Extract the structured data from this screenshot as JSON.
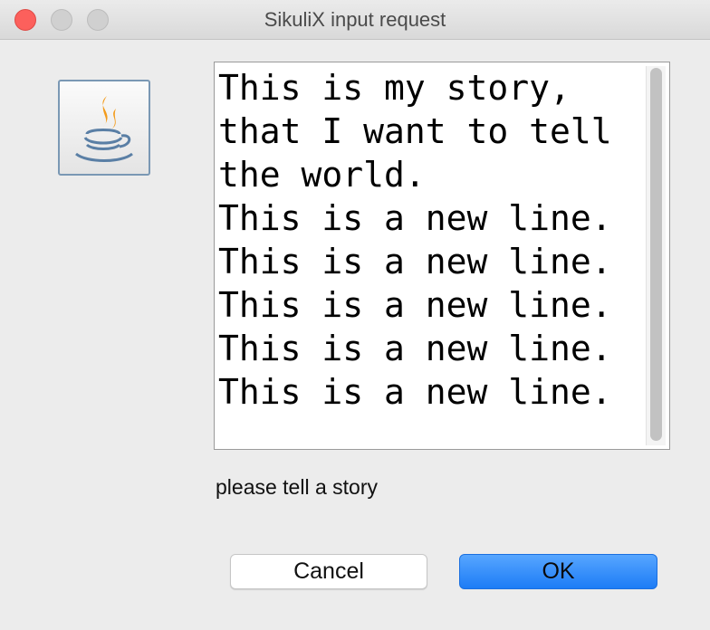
{
  "window": {
    "title": "SikuliX input request"
  },
  "icon": {
    "name": "java-cup-icon",
    "colors": {
      "steam": "#f39b1b",
      "cup": "#5a7fa5",
      "frame": "#7a98b4"
    }
  },
  "story": {
    "text": "This is my story,\nthat I want to tell\nthe world.\nThis is a new line.\nThis is a new line.\nThis is a new line.\nThis is a new line.\nThis is a new line."
  },
  "prompt": {
    "label": "please tell a story"
  },
  "buttons": {
    "cancel_label": "Cancel",
    "ok_label": "OK"
  },
  "colors": {
    "close": "#fc605c",
    "accent": "#1d7cf6"
  }
}
